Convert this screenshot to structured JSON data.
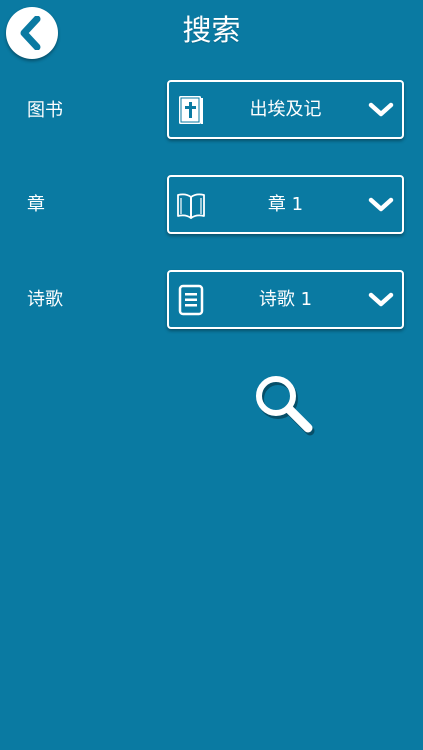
{
  "header": {
    "title": "搜索"
  },
  "form": {
    "book": {
      "label": "图书",
      "value": "出埃及记"
    },
    "chapter": {
      "label": "章",
      "value": "章 1"
    },
    "verse": {
      "label": "诗歌",
      "value": "诗歌 1"
    }
  },
  "icons": {
    "back": "chevron-left-icon",
    "book": "bible-book-icon",
    "chapter": "open-book-icon",
    "verse": "document-lines-icon",
    "dropdown": "chevron-down-icon",
    "search": "magnifier-icon"
  },
  "colors": {
    "background": "#0a7aa2",
    "foreground": "#ffffff",
    "back_chevron": "#0a7aa2"
  }
}
